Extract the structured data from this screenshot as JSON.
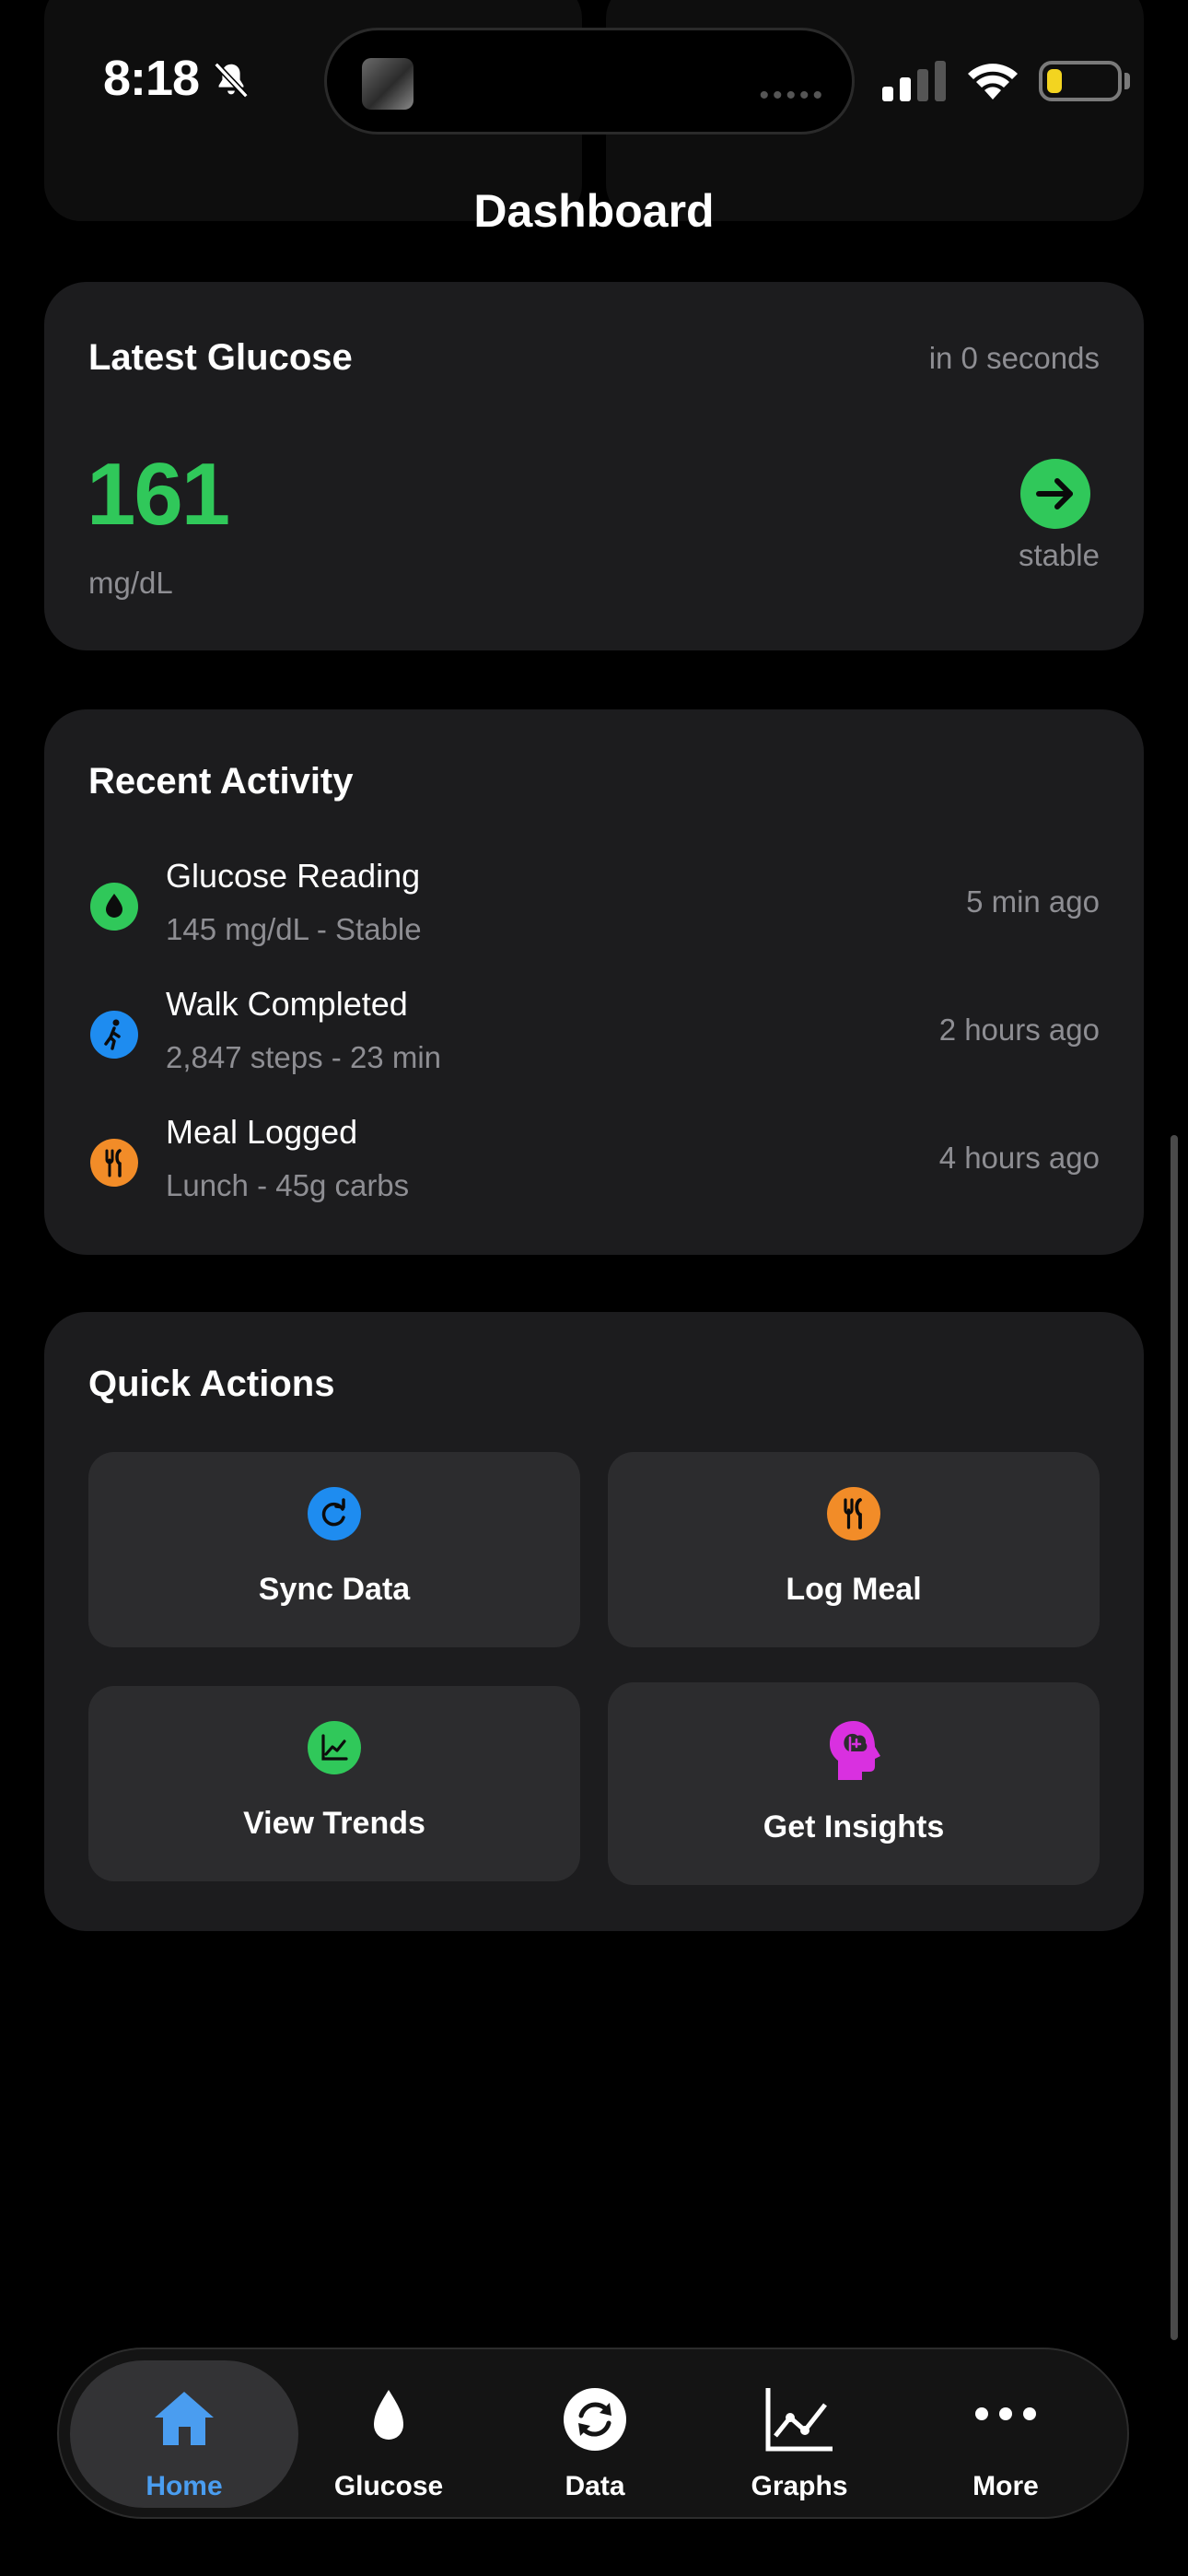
{
  "status_bar": {
    "time": "8:18"
  },
  "header": {
    "title": "Dashboard"
  },
  "latest_glucose": {
    "title": "Latest Glucose",
    "updated": "in 0 seconds",
    "value": "161",
    "unit": "mg/dL",
    "trend": "stable",
    "value_color": "#30c85a"
  },
  "recent_activity": {
    "title": "Recent Activity",
    "items": [
      {
        "title": "Glucose Reading",
        "subtitle": "145 mg/dL - Stable",
        "time": "5 min ago",
        "icon": "droplet-icon",
        "color": "#30c85a"
      },
      {
        "title": "Walk Completed",
        "subtitle": "2,847 steps - 23 min",
        "time": "2 hours ago",
        "icon": "walk-icon",
        "color": "#1e8cf0"
      },
      {
        "title": "Meal Logged",
        "subtitle": "Lunch - 45g carbs",
        "time": "4 hours ago",
        "icon": "utensils-icon",
        "color": "#f28c28"
      }
    ]
  },
  "quick_actions": {
    "title": "Quick Actions",
    "items": [
      {
        "label": "Sync Data",
        "icon": "sync-icon",
        "color": "#1e8cf0"
      },
      {
        "label": "Log Meal",
        "icon": "utensils-icon",
        "color": "#f28c28"
      },
      {
        "label": "View Trends",
        "icon": "trend-chart-icon",
        "color": "#30c85a"
      },
      {
        "label": "Get Insights",
        "icon": "brain-head-icon",
        "color": "#d930e0"
      }
    ]
  },
  "tab_bar": {
    "active": "Home",
    "accent": "#4a9df0",
    "tabs": [
      {
        "label": "Home",
        "icon": "home-icon"
      },
      {
        "label": "Glucose",
        "icon": "droplet-icon"
      },
      {
        "label": "Data",
        "icon": "sync-icon"
      },
      {
        "label": "Graphs",
        "icon": "line-chart-icon"
      },
      {
        "label": "More",
        "icon": "more-dots-icon"
      }
    ]
  }
}
